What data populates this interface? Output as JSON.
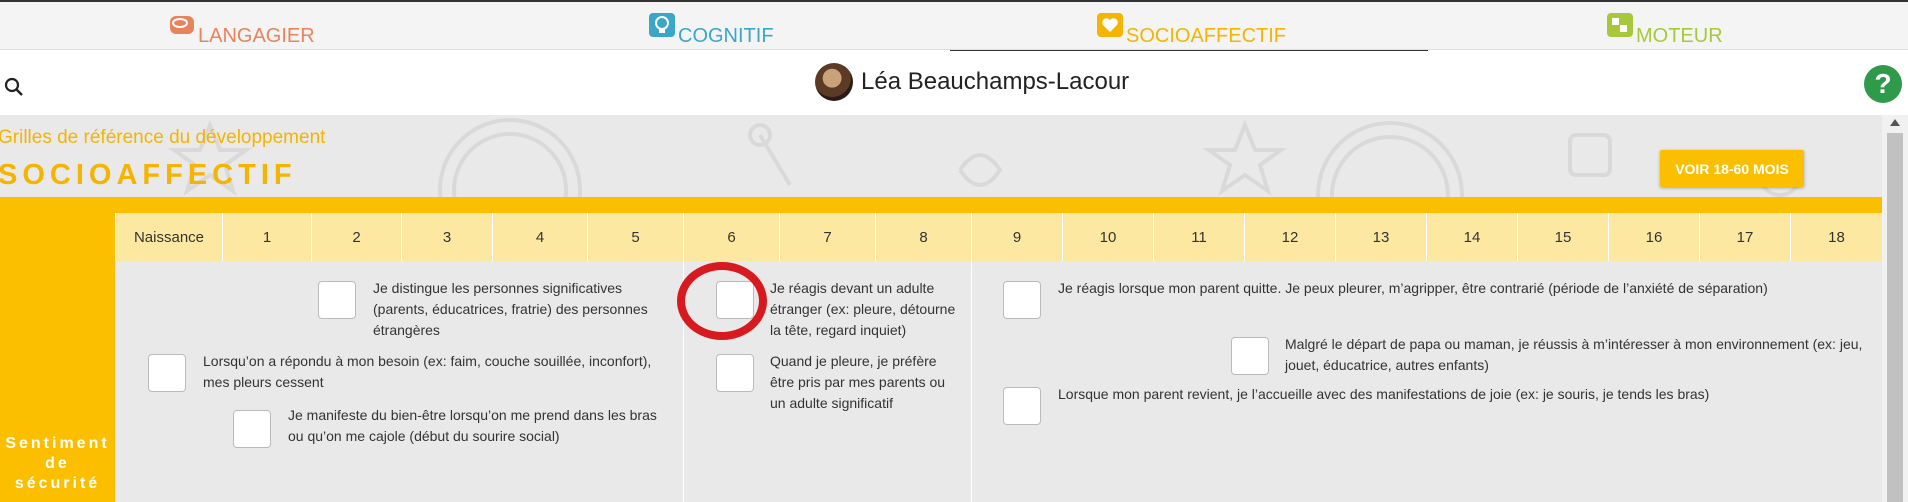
{
  "tabs": [
    {
      "label": "LANGAGIER",
      "color": "#e8845c",
      "icon": "speech-bubbles-icon"
    },
    {
      "label": "COGNITIF",
      "color": "#3aa7c9",
      "icon": "lightbulb-icon"
    },
    {
      "label": "SOCIOAFFECTIF",
      "color": "#f4b400",
      "icon": "heart-icon",
      "active": true
    },
    {
      "label": "MOTEUR",
      "color": "#a7c83a",
      "icon": "blocks-icon"
    }
  ],
  "header": {
    "username": "Léa Beauchamps-Lacour",
    "help_label": "?"
  },
  "page": {
    "subtitle": "Grilles de référence du développement",
    "title": "SOCIOAFFECTIF",
    "voir_button": "VOIR 18-60 MOIS"
  },
  "months": [
    "Naissance",
    "1",
    "2",
    "3",
    "4",
    "5",
    "6",
    "7",
    "8",
    "9",
    "10",
    "11",
    "12",
    "13",
    "14",
    "15",
    "16",
    "17",
    "18"
  ],
  "row": {
    "label_lines": [
      "Sentiment",
      "de",
      "sécurité"
    ],
    "items": [
      {
        "text": "Je distingue les personnes significatives (parents, éducatrices, fratrie) des personnes étrangères"
      },
      {
        "text": "Lorsqu’on a répondu à mon besoin (ex: faim, couche souillée, inconfort), mes pleurs cessent"
      },
      {
        "text": "Je manifeste du bien-être lorsqu’on me prend dans les bras ou qu’on me cajole (début du sourire social)"
      },
      {
        "text": "Je réagis devant un adulte étranger (ex: pleure, détourne la tête, regard inquiet)"
      },
      {
        "text": "Quand je pleure, je préfère être pris par mes parents ou un adulte significatif"
      },
      {
        "text": "Je réagis lorsque mon parent quitte. Je peux pleurer, m’agripper, être contrarié (période de l’anxiété de séparation)"
      },
      {
        "text": "Malgré le départ de papa ou maman, je réussis à m’intéresser à mon environnement (ex: jeu, jouet, éducatrice, autres enfants)"
      },
      {
        "text": "Lorsque mon parent revient, je l’accueille avec des manifestations de joie (ex: je souris, je tends les bras)"
      }
    ]
  }
}
